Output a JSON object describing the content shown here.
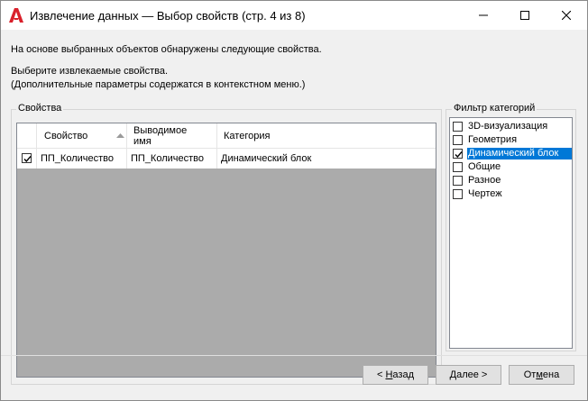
{
  "window": {
    "title": "Извлечение данных — Выбор свойств (стр. 4 из 8)",
    "app_icon": "autocad-a-icon",
    "controls": [
      "minimize-icon",
      "maximize-icon",
      "close-icon"
    ]
  },
  "intro": {
    "line1": "На основе выбранных объектов обнаружены следующие свойства.",
    "line2": "Выберите извлекаемые свойства.",
    "line3": "(Дополнительные параметры содержатся в контекстном меню.)"
  },
  "properties": {
    "group_label": "Свойства",
    "columns": {
      "property": "Свойство",
      "display_name_1": "Выводимое",
      "display_name_2": "имя",
      "category": "Категория"
    },
    "sort_indicator": "sort-ascending-icon",
    "rows": [
      {
        "checked": true,
        "property": "ПП_Количество",
        "display_name": "ПП_Количество",
        "category": "Динамический блок"
      }
    ]
  },
  "category_filter": {
    "label": "Фильтр категорий",
    "items": [
      {
        "label": "3D-визуализация",
        "checked": false,
        "selected": false
      },
      {
        "label": "Геометрия",
        "checked": false,
        "selected": false
      },
      {
        "label": "Динамический блок",
        "checked": true,
        "selected": true
      },
      {
        "label": "Общие",
        "checked": false,
        "selected": false
      },
      {
        "label": "Разное",
        "checked": false,
        "selected": false
      },
      {
        "label": "Чертеж",
        "checked": false,
        "selected": false
      }
    ]
  },
  "buttons": {
    "back_prefix": "< ",
    "back_mnemonic": "Н",
    "back_rest": "азад",
    "next_mnemonic": "Д",
    "next_rest": "алее >",
    "cancel_prefix": "От",
    "cancel_mnemonic": "м",
    "cancel_rest": "ена"
  },
  "colors": {
    "selection": "#0078d7",
    "grid_empty": "#ababab",
    "app_icon_red": "#d9202b"
  }
}
